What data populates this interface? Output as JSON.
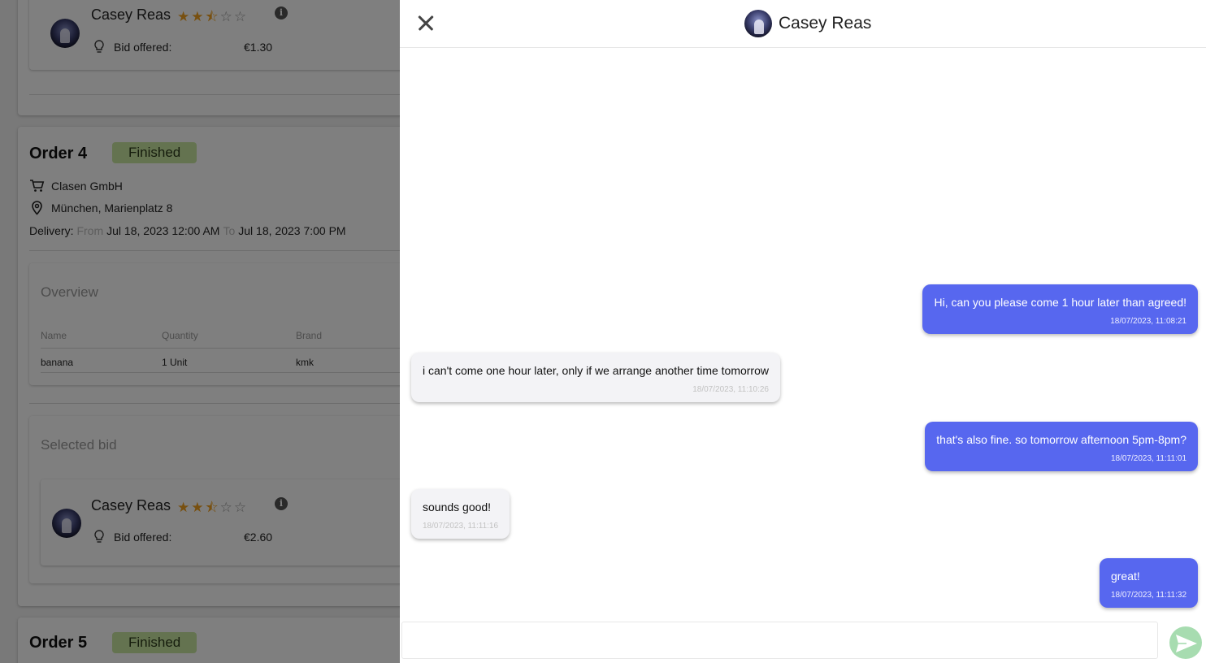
{
  "background": {
    "bid_top": {
      "bidder": "Casey Reas",
      "rating": 2.5,
      "bid_label": "Bid offered:",
      "bid_value": "€1.30"
    },
    "order4": {
      "title": "Order 4",
      "status": "Finished",
      "shop": "Clasen GmbH",
      "address": "München, Marienplatz 8",
      "delivery_label": "Delivery:",
      "from_label": "From",
      "from_value": "Jul 18, 2023 12:00 AM",
      "to_label": "To",
      "to_value": "Jul 18, 2023 7:00 PM",
      "overview_title": "Overview",
      "table_headers": [
        "Name",
        "Quantity",
        "Brand"
      ],
      "table_rows": [
        [
          "banana",
          "1 Unit",
          "kmk"
        ]
      ],
      "selected_bid_title": "Selected bid",
      "bid": {
        "bidder": "Casey Reas",
        "rating": 2.5,
        "bid_label": "Bid offered:",
        "bid_value": "€2.60"
      }
    },
    "order5": {
      "title": "Order 5",
      "status": "Finished"
    }
  },
  "chat": {
    "contact_name": "Casey Reas",
    "messages": [
      {
        "direction": "out",
        "text": "Hi, can you please come 1 hour later than agreed!",
        "time": "18/07/2023, 11:08:21"
      },
      {
        "direction": "in",
        "text": "i can't come one hour later, only if we arrange another time tomorrow",
        "time": "18/07/2023, 11:10:26"
      },
      {
        "direction": "out",
        "text": "that's also fine. so tomorrow afternoon 5pm-8pm?",
        "time": "18/07/2023, 11:11:01"
      },
      {
        "direction": "in",
        "text": "sounds good!",
        "time": "18/07/2023, 11:11:16"
      },
      {
        "direction": "out",
        "text": "great!",
        "time": "18/07/2023, 11:11:32"
      }
    ],
    "composer_value": ""
  },
  "colors": {
    "outgoing_bubble": "#5767ef",
    "incoming_bubble": "#f3f3f6",
    "status_badge": "#c8e6a0",
    "send_button": "#a7dcb0",
    "star": "#f0a020"
  },
  "icons": [
    "close-icon",
    "avatar",
    "cart-icon",
    "location-pin-icon",
    "info-icon",
    "lightbulb-icon",
    "send-icon",
    "star-icon"
  ]
}
